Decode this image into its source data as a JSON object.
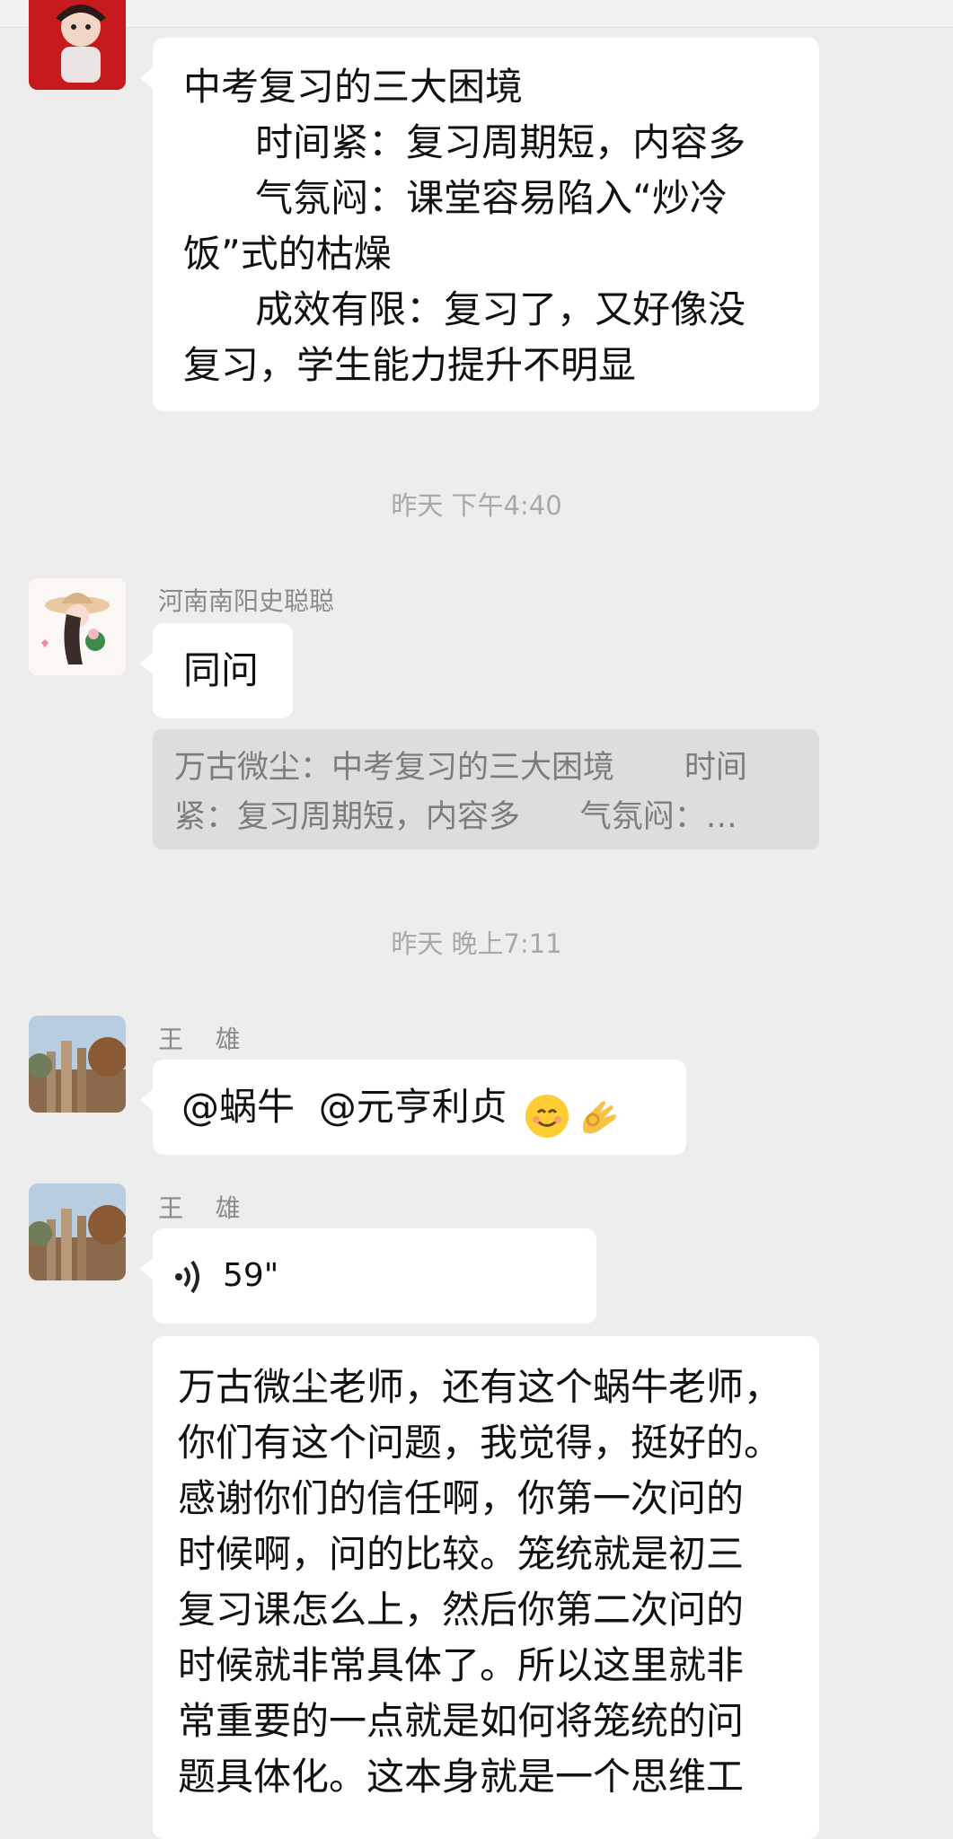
{
  "messages": [
    {
      "sender": "",
      "lines": [
        "中考复习的三大困境",
        "      时间紧：复习周期短，内容多",
        "      气氛闷：课堂容易陷入“炒冷",
        "饭”式的枯燥",
        "      成效有限：复习了，又好像没",
        "复习，学生能力提升不明显"
      ]
    },
    {
      "sender": "河南南阳史聪聪",
      "text": "同问",
      "quote_lines": [
        "万古微尘：中考复习的三大困境       时间",
        "紧：复习周期短，内容多      气氛闷：…"
      ]
    },
    {
      "sender": "王    雄",
      "text": "@蜗牛  @元亨利贞 ",
      "emoji_icons": [
        "smiling-face-icon",
        "ok-hand-icon"
      ]
    },
    {
      "sender": "王    雄",
      "voice_duration": "59\""
    },
    {
      "lines": [
        "万古微尘老师，还有这个蜗牛老师，",
        "你们有这个问题，我觉得，挺好的。",
        "感谢你们的信任啊，你第一次问的",
        "时候啊，问的比较。笼统就是初三",
        "复习课怎么上，然后你第二次问的",
        "时候就非常具体了。所以这里就非",
        "常重要的一点就是如何将笼统的问",
        "题具体化。这本身就是一个思维工"
      ]
    }
  ],
  "timestamps": [
    "昨天 下午4:40",
    "昨天 晚上7:11"
  ],
  "colors": {
    "background": "#ededed",
    "bubble": "#ffffff",
    "quote_bg": "#dddddd",
    "meta_text": "#a8a8a8"
  }
}
